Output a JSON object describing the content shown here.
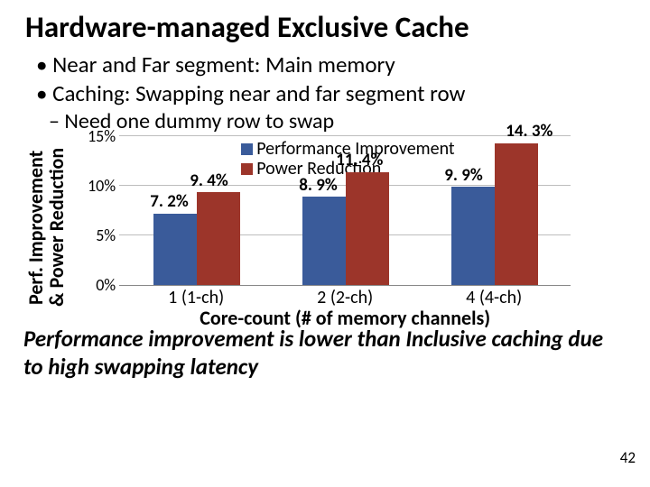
{
  "title": "Hardware-managed Exclusive Cache",
  "bullets": [
    "Near and Far segment: Main memory",
    "Caching: Swapping near and far segment row"
  ],
  "sub_bullet": "Need one dummy row to swap",
  "y_axis_label": "Perf. Improvement\n& Power Reduction",
  "legend": {
    "perf": "Performance Improvement",
    "pwr": "Power Reduction"
  },
  "y_ticks": [
    "0%",
    "5%",
    "10%",
    "15%"
  ],
  "x_label": "Core-count (# of memory channels)",
  "data_labels": {
    "perf": [
      "7. 2%",
      "8. 9%",
      "9. 9%"
    ],
    "pwr": [
      "9. 4%",
      "11. 4%",
      "14. 3%"
    ]
  },
  "x_ticks": [
    "1 (1-ch)",
    "2 (2-ch)",
    "4 (4-ch)"
  ],
  "footer": "Performance improvement is lower than Inclusive caching due to high swapping latency",
  "page_number": "42",
  "chart_data": {
    "type": "bar",
    "title": "",
    "xlabel": "Core-count (# of memory channels)",
    "ylabel": "Perf. Improvement & Power Reduction",
    "ylim": [
      0,
      15
    ],
    "categories": [
      "1 (1-ch)",
      "2 (2-ch)",
      "4 (4-ch)"
    ],
    "series": [
      {
        "name": "Performance Improvement",
        "values": [
          7.2,
          8.9,
          9.9
        ]
      },
      {
        "name": "Power Reduction",
        "values": [
          9.4,
          11.4,
          14.3
        ]
      }
    ]
  }
}
